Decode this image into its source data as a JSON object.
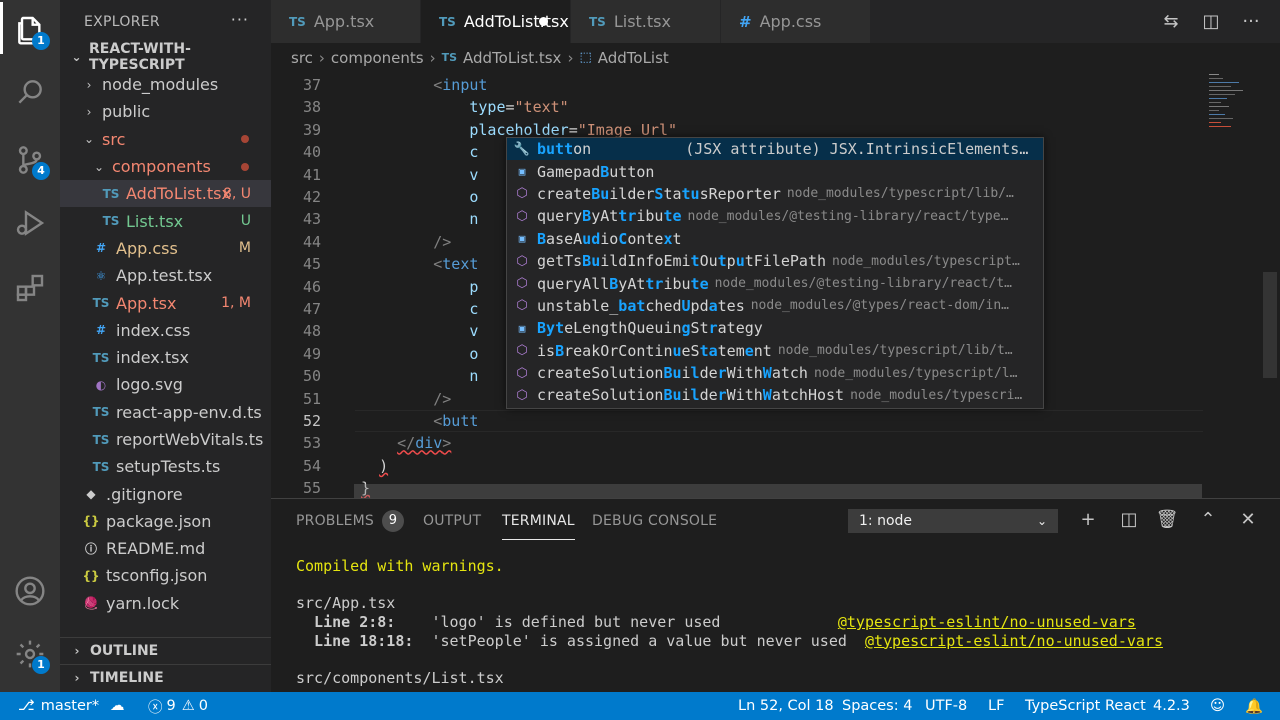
{
  "activity_bar": {
    "explorer_badge": "1",
    "scm_badge": "4",
    "settings_badge": "1"
  },
  "sidebar": {
    "title": "EXPLORER",
    "more": "···",
    "root": "REACT-WITH-TYPESCRIPT",
    "items": [
      {
        "label": "node_modules",
        "chev": "›",
        "icon": "",
        "badge": "",
        "dot": false,
        "indent": 0
      },
      {
        "label": "public",
        "chev": "›",
        "icon": "",
        "badge": "",
        "dot": false,
        "indent": 0
      },
      {
        "label": "src",
        "chev": "⌄",
        "icon": "",
        "badge": "",
        "dot": true,
        "indent": 0
      },
      {
        "label": "components",
        "chev": "⌄",
        "icon": "",
        "badge": "",
        "dot": true,
        "indent": 1
      },
      {
        "label": "AddToList.tsx",
        "chev": "",
        "icon": "TS",
        "badge": "8, U",
        "dot": false,
        "indent": 2
      },
      {
        "label": "List.tsx",
        "chev": "",
        "icon": "TS",
        "badge": "U",
        "dot": false,
        "indent": 2
      },
      {
        "label": "App.css",
        "chev": "",
        "icon": "#",
        "badge": "M",
        "dot": false,
        "indent": 1
      },
      {
        "label": "App.test.tsx",
        "chev": "",
        "icon": "⚛",
        "badge": "",
        "dot": false,
        "indent": 1
      },
      {
        "label": "App.tsx",
        "chev": "",
        "icon": "TS",
        "badge": "1, M",
        "dot": false,
        "indent": 1
      },
      {
        "label": "index.css",
        "chev": "",
        "icon": "#",
        "badge": "",
        "dot": false,
        "indent": 1
      },
      {
        "label": "index.tsx",
        "chev": "",
        "icon": "TS",
        "badge": "",
        "dot": false,
        "indent": 1
      },
      {
        "label": "logo.svg",
        "chev": "",
        "icon": "◐",
        "badge": "",
        "dot": false,
        "indent": 1
      },
      {
        "label": "react-app-env.d.ts",
        "chev": "",
        "icon": "TS",
        "badge": "",
        "dot": false,
        "indent": 1
      },
      {
        "label": "reportWebVitals.ts",
        "chev": "",
        "icon": "TS",
        "badge": "",
        "dot": false,
        "indent": 1
      },
      {
        "label": "setupTests.ts",
        "chev": "",
        "icon": "TS",
        "badge": "",
        "dot": false,
        "indent": 1
      },
      {
        "label": ".gitignore",
        "chev": "",
        "icon": "◆",
        "badge": "",
        "dot": false,
        "indent": 0
      },
      {
        "label": "package.json",
        "chev": "",
        "icon": "{}",
        "badge": "",
        "dot": false,
        "indent": 0
      },
      {
        "label": "README.md",
        "chev": "",
        "icon": "ⓘ",
        "badge": "",
        "dot": false,
        "indent": 0
      },
      {
        "label": "tsconfig.json",
        "chev": "",
        "icon": "{}",
        "badge": "",
        "dot": false,
        "indent": 0
      },
      {
        "label": "yarn.lock",
        "chev": "",
        "icon": "🧶",
        "badge": "",
        "dot": false,
        "indent": 0
      }
    ],
    "outline": "OUTLINE",
    "timeline": "TIMELINE"
  },
  "tabs": [
    {
      "icon": "TS",
      "label": "App.tsx",
      "active": false,
      "dirty": false
    },
    {
      "icon": "TS",
      "label": "AddToList.tsx",
      "active": true,
      "dirty": true
    },
    {
      "icon": "TS",
      "label": "List.tsx",
      "active": false,
      "dirty": false
    },
    {
      "icon": "#",
      "label": "App.css",
      "active": false,
      "dirty": false
    }
  ],
  "breadcrumb": {
    "parts": [
      "src",
      "components",
      "AddToList.tsx",
      "AddToList"
    ],
    "ts_icon": "TS"
  },
  "editor": {
    "line_numbers": [
      "37",
      "38",
      "39",
      "40",
      "41",
      "42",
      "43",
      "44",
      "45",
      "46",
      "47",
      "48",
      "49",
      "50",
      "51",
      "52",
      "53",
      "54",
      "55"
    ],
    "current_line": "52",
    "lines": [
      {
        "indent": "        ",
        "parts": [
          [
            "tag",
            "<"
          ],
          [
            "tagname",
            "input"
          ]
        ]
      },
      {
        "indent": "            ",
        "parts": [
          [
            "attr",
            "type"
          ],
          [
            "plain",
            "="
          ],
          [
            "str",
            "\"text\""
          ]
        ]
      },
      {
        "indent": "            ",
        "parts": [
          [
            "attr",
            "placeholder"
          ],
          [
            "plain",
            "="
          ],
          [
            "str",
            "\"Image Url\""
          ]
        ]
      },
      {
        "indent": "            ",
        "parts": [
          [
            "attr",
            "c"
          ]
        ]
      },
      {
        "indent": "            ",
        "parts": [
          [
            "attr",
            "v"
          ]
        ]
      },
      {
        "indent": "            ",
        "parts": [
          [
            "attr",
            "o"
          ]
        ]
      },
      {
        "indent": "            ",
        "parts": [
          [
            "attr",
            "n"
          ]
        ]
      },
      {
        "indent": "        ",
        "parts": [
          [
            "tag",
            "/>"
          ]
        ]
      },
      {
        "indent": "        ",
        "parts": [
          [
            "tag",
            "<"
          ],
          [
            "tagname",
            "text"
          ]
        ]
      },
      {
        "indent": "            ",
        "parts": [
          [
            "attr",
            "p"
          ]
        ]
      },
      {
        "indent": "            ",
        "parts": [
          [
            "attr",
            "c"
          ]
        ]
      },
      {
        "indent": "            ",
        "parts": [
          [
            "attr",
            "v"
          ]
        ]
      },
      {
        "indent": "            ",
        "parts": [
          [
            "attr",
            "o"
          ]
        ]
      },
      {
        "indent": "            ",
        "parts": [
          [
            "attr",
            "n"
          ]
        ]
      },
      {
        "indent": "        ",
        "parts": [
          [
            "tag",
            "/>"
          ]
        ]
      },
      {
        "indent": "        ",
        "parts": [
          [
            "tag",
            "<"
          ],
          [
            "tagname",
            "butt"
          ]
        ]
      },
      {
        "indent": "    ",
        "parts": [
          [
            "tag",
            "</"
          ],
          [
            "tagname",
            "div"
          ],
          [
            "tag",
            ">"
          ]
        ]
      },
      {
        "indent": "  ",
        "parts": [
          [
            "plain",
            ")"
          ]
        ]
      },
      {
        "indent": "",
        "parts": [
          [
            "plain",
            "}"
          ]
        ]
      }
    ]
  },
  "suggest": {
    "items": [
      {
        "icon": "wrench",
        "label": "button",
        "match": [
          0,
          6
        ],
        "detail": "(JSX attribute) JSX.IntrinsicElements…",
        "big": true
      },
      {
        "icon": "box",
        "label": "GamepadButton",
        "match": [
          7,
          13
        ],
        "detail": ""
      },
      {
        "icon": "cube",
        "label": "createBuilderStatusReporter",
        "match": [
          6,
          7,
          13,
          16,
          17
        ],
        "detail": "node_modules/typescript/lib/…"
      },
      {
        "icon": "cube",
        "label": "queryByAttribute",
        "match": [
          5,
          9,
          10,
          14,
          15
        ],
        "detail": "node_modules/@testing-library/react/type…"
      },
      {
        "icon": "box",
        "label": "BaseAudioContext",
        "match": [
          0,
          5,
          6,
          9,
          14
        ],
        "detail": ""
      },
      {
        "icon": "cube",
        "label": "getTsBuildInfoEmitOutputFilePath",
        "match": [
          5,
          6,
          17,
          20,
          22
        ],
        "detail": "node_modules/typescript…"
      },
      {
        "icon": "cube",
        "label": "queryAllByAttribute",
        "match": [
          8,
          12,
          13,
          17,
          18
        ],
        "detail": "node_modules/@testing-library/react/t…"
      },
      {
        "icon": "cube",
        "label": "unstable_batchedUpdates",
        "match": [
          9,
          10,
          11,
          16,
          19
        ],
        "detail": "node_modules/@types/react-dom/in…"
      },
      {
        "icon": "box",
        "label": "ByteLengthQueuingStrategy",
        "match": [
          0,
          1,
          2,
          16,
          19
        ],
        "detail": ""
      },
      {
        "icon": "cube",
        "label": "isBreakOrContinueStatement",
        "match": [
          2,
          15,
          18,
          19,
          23
        ],
        "detail": "node_modules/typescript/lib/t…"
      },
      {
        "icon": "cube",
        "label": "createSolutionBuilderWithWatch",
        "match": [
          14,
          15,
          17,
          20,
          25
        ],
        "detail": "node_modules/typescript/l…"
      },
      {
        "icon": "cube",
        "label": "createSolutionBuilderWithWatchHost",
        "match": [
          14,
          15,
          17,
          20,
          25
        ],
        "detail": "node_modules/typescri…"
      }
    ]
  },
  "panel": {
    "tabs": [
      "PROBLEMS",
      "OUTPUT",
      "TERMINAL",
      "DEBUG CONSOLE"
    ],
    "problems_count": "9",
    "active_tab": "TERMINAL",
    "terminal_select": "1: node",
    "terminal_lines": [
      {
        "text": "Compiled with warnings.",
        "cls": "t-yellow"
      },
      {
        "text": "",
        "cls": ""
      },
      {
        "text": "src/App.tsx",
        "cls": ""
      },
      {
        "loc": "  Line 2:8:  ",
        "msg": "  'logo' is defined but never used             ",
        "rule": "@typescript-eslint/no-unused-vars"
      },
      {
        "loc": "  Line 18:18:",
        "msg": "  'setPeople' is assigned a value but never used  ",
        "rule": "@typescript-eslint/no-unused-vars"
      },
      {
        "text": "",
        "cls": ""
      },
      {
        "text": "src/components/List.tsx",
        "cls": ""
      }
    ]
  },
  "statusbar": {
    "branch": "master*",
    "errors": "9",
    "warnings": "0",
    "position": "Ln 52, Col 18",
    "spaces": "Spaces: 4",
    "encoding": "UTF-8",
    "eol": "LF",
    "language": "TypeScript React",
    "ts_version": "4.2.3"
  }
}
